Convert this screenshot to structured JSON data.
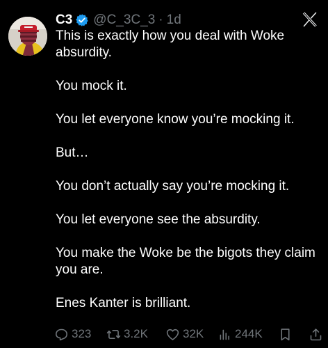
{
  "tweet": {
    "display_name": "C3",
    "handle": "@C_3C_3",
    "separator": "·",
    "time": "1d",
    "paragraphs": [
      "This is exactly how you deal with Woke absurdity.",
      "You mock it.",
      "You let everyone know you’re mocking it.",
      "But…",
      "You don’t actually say you’re mocking it.",
      "You let everyone see the absurdity.",
      "You make the Woke be the bigots they claim you are.",
      "Enes Kanter is brilliant."
    ]
  },
  "actions": {
    "replies": "323",
    "reposts": "3.2K",
    "likes": "32K",
    "views": "244K"
  },
  "icons": {
    "verified": "verified-badge-icon",
    "brand": "x-logo-icon",
    "reply": "reply-icon",
    "repost": "repost-icon",
    "like": "heart-icon",
    "views": "analytics-icon",
    "bookmark": "bookmark-icon",
    "share": "share-icon"
  },
  "colors": {
    "background": "#000000",
    "text": "#ffffff",
    "secondary": "#71767b",
    "verified": "#1d9bf0"
  }
}
